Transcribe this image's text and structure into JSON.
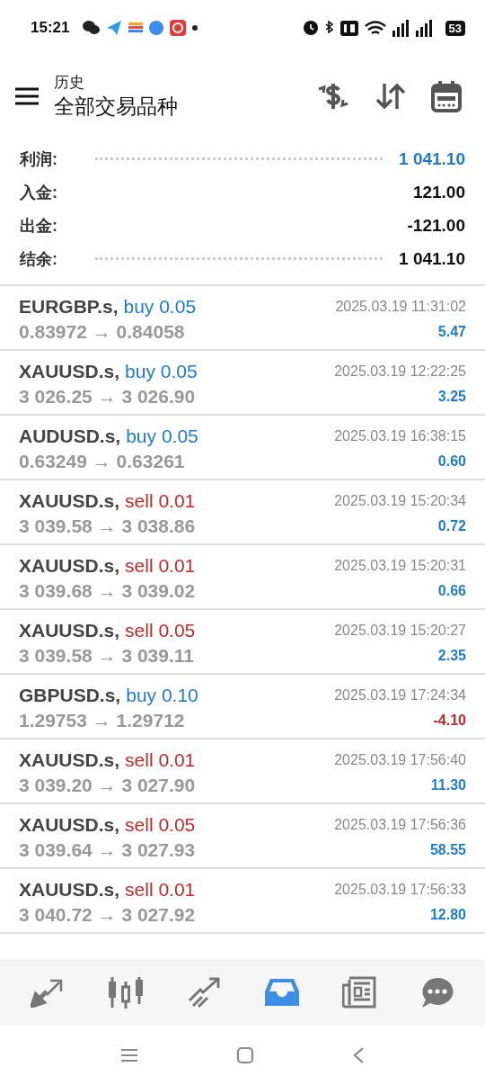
{
  "status_bar": {
    "time": "15:21",
    "battery": "53"
  },
  "header": {
    "subtitle": "历史",
    "title": "全部交易品种"
  },
  "summary": [
    {
      "label": "利润:",
      "value": "1 041.10",
      "highlight": true,
      "leader": true
    },
    {
      "label": "入金:",
      "value": "121.00",
      "highlight": false,
      "leader": false
    },
    {
      "label": "出金:",
      "value": "-121.00",
      "highlight": false,
      "leader": false
    },
    {
      "label": "结余:",
      "value": "1 041.10",
      "highlight": false,
      "leader": true
    }
  ],
  "trades": [
    {
      "symbol": "EURGBP.s,",
      "kind": "buy",
      "order": "buy 0.05",
      "prices": "0.83972 → 0.84058",
      "time": "2025.03.19 11:31:02",
      "profit": "5.47",
      "loss": false
    },
    {
      "symbol": "XAUUSD.s,",
      "kind": "buy",
      "order": "buy 0.05",
      "prices": "3 026.25 → 3 026.90",
      "time": "2025.03.19 12:22:25",
      "profit": "3.25",
      "loss": false
    },
    {
      "symbol": "AUDUSD.s,",
      "kind": "buy",
      "order": "buy 0.05",
      "prices": "0.63249 → 0.63261",
      "time": "2025.03.19 16:38:15",
      "profit": "0.60",
      "loss": false
    },
    {
      "symbol": "XAUUSD.s,",
      "kind": "sell",
      "order": "sell 0.01",
      "prices": "3 039.58 → 3 038.86",
      "time": "2025.03.19 15:20:34",
      "profit": "0.72",
      "loss": false
    },
    {
      "symbol": "XAUUSD.s,",
      "kind": "sell",
      "order": "sell 0.01",
      "prices": "3 039.68 → 3 039.02",
      "time": "2025.03.19 15:20:31",
      "profit": "0.66",
      "loss": false
    },
    {
      "symbol": "XAUUSD.s,",
      "kind": "sell",
      "order": "sell 0.05",
      "prices": "3 039.58 → 3 039.11",
      "time": "2025.03.19 15:20:27",
      "profit": "2.35",
      "loss": false
    },
    {
      "symbol": "GBPUSD.s,",
      "kind": "buy",
      "order": "buy 0.10",
      "prices": "1.29753 → 1.29712",
      "time": "2025.03.19 17:24:34",
      "profit": "-4.10",
      "loss": true
    },
    {
      "symbol": "XAUUSD.s,",
      "kind": "sell",
      "order": "sell 0.01",
      "prices": "3 039.20 → 3 027.90",
      "time": "2025.03.19 17:56:40",
      "profit": "11.30",
      "loss": false
    },
    {
      "symbol": "XAUUSD.s,",
      "kind": "sell",
      "order": "sell 0.05",
      "prices": "3 039.64 → 3 027.93",
      "time": "2025.03.19 17:56:36",
      "profit": "58.55",
      "loss": false
    },
    {
      "symbol": "XAUUSD.s,",
      "kind": "sell",
      "order": "sell 0.01",
      "prices": "3 040.72 → 3 027.92",
      "time": "2025.03.19 17:56:33",
      "profit": "12.80",
      "loss": false
    }
  ],
  "bottom_nav": [
    {
      "kind": "trade",
      "selected": false
    },
    {
      "kind": "chart",
      "selected": false
    },
    {
      "kind": "trend",
      "selected": false
    },
    {
      "kind": "history",
      "selected": true
    },
    {
      "kind": "news",
      "selected": false
    },
    {
      "kind": "chat",
      "selected": false
    }
  ]
}
